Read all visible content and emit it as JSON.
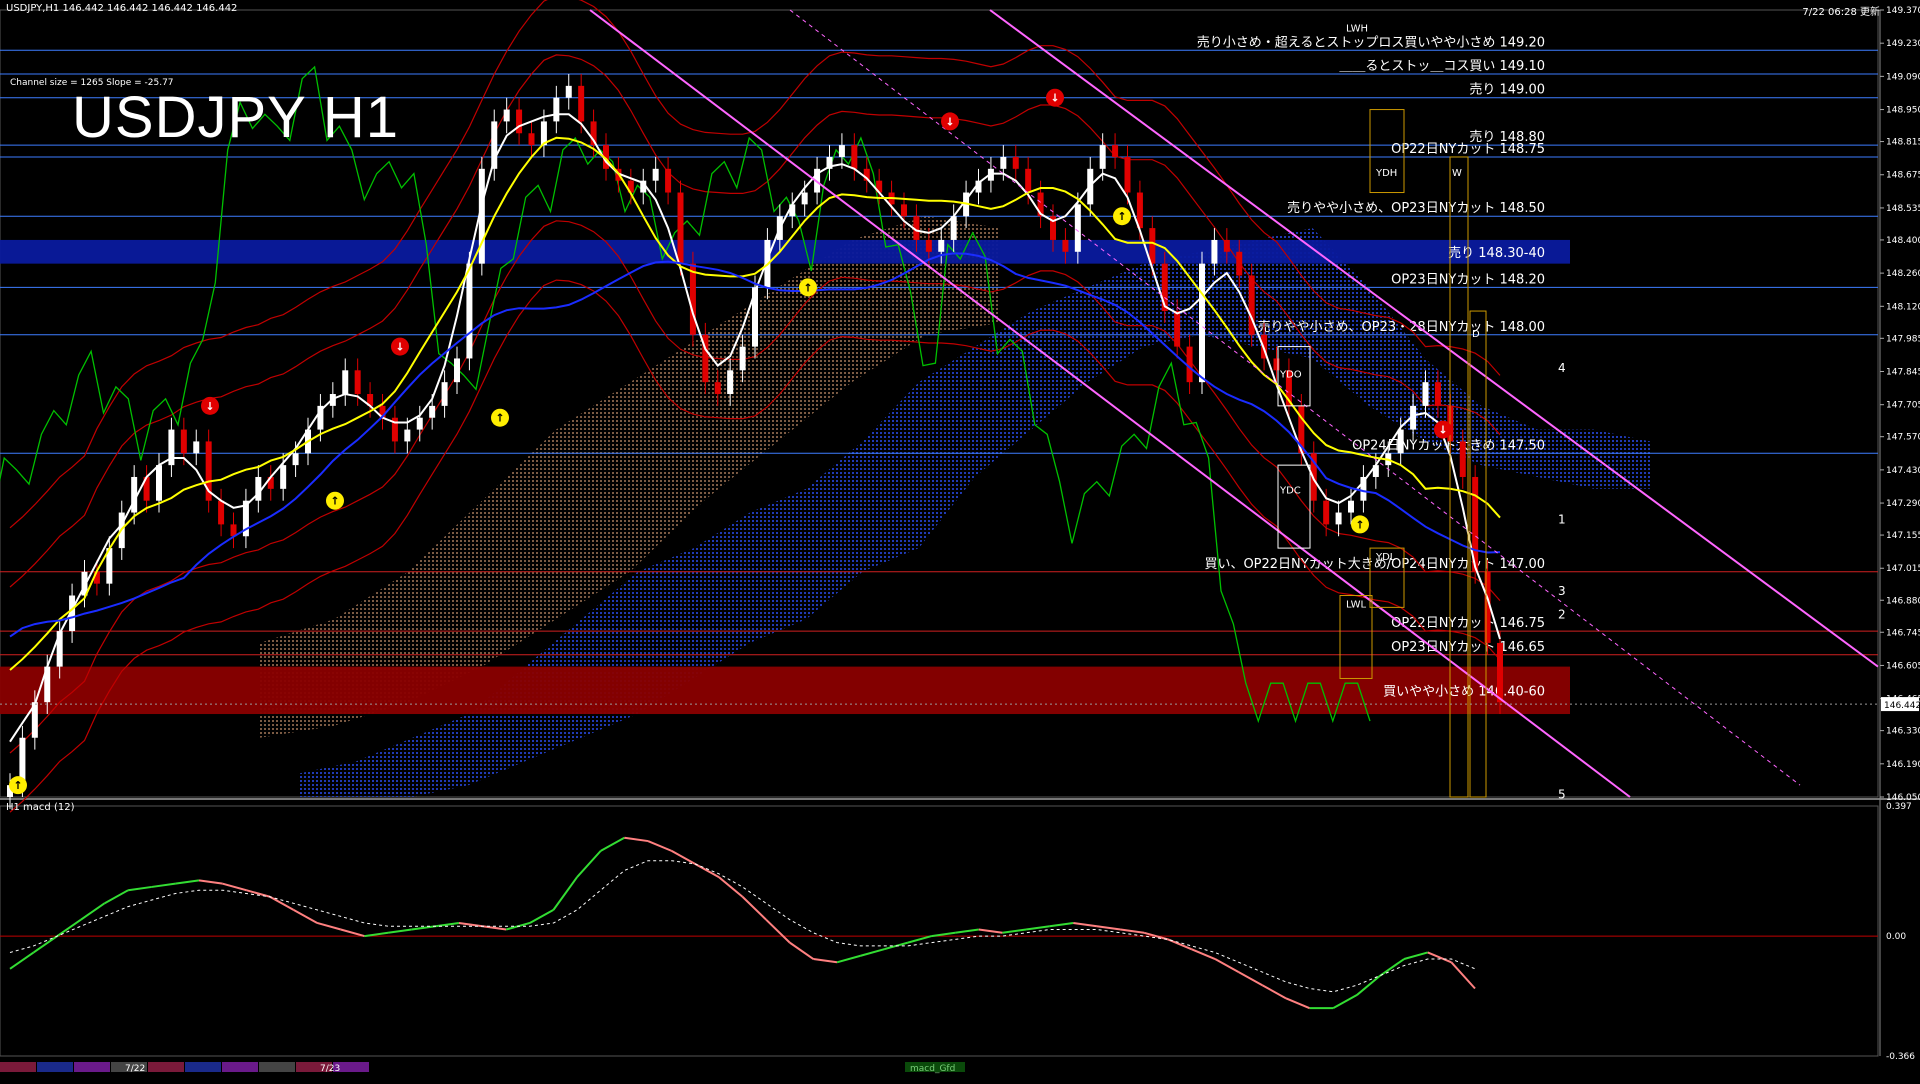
{
  "header": {
    "symbol_info": "USDJPY,H1  146.442 146.442 146.442 146.442",
    "updated": "7/22 06:28 更新",
    "channel_info": "Channel size = 1265 Slope = -25.77",
    "title": "USDJPY H1"
  },
  "colors": {
    "background": "#000000",
    "candle_up": "#ffffff",
    "candle_down": "#e00000",
    "ma_fast": "#ffffff",
    "ma_mid": "#ffff00",
    "ma_slow": "#1a2cff",
    "bollinger": "#c00000",
    "chikou": "#00c000",
    "channel": "#ff66ff",
    "level_line": "#3d7dff",
    "sell_zone": "#0a1a9e",
    "buy_zone": "#8a0000",
    "kumo": "#2440c8",
    "macd_up": "#33dd33",
    "macd_down": "#ff8080",
    "macd_signal": "#ffffff"
  },
  "chart_data": [
    {
      "type": "line",
      "name_hint": "price-panel",
      "ylim": [
        146.05,
        149.37
      ],
      "yaxis_ticks": [
        "149.370",
        "149.230",
        "149.090",
        "148.950",
        "148.815",
        "148.675",
        "148.535",
        "148.400",
        "148.260",
        "148.120",
        "147.985",
        "147.845",
        "147.705",
        "147.570",
        "147.430",
        "147.290",
        "147.155",
        "147.015",
        "146.880",
        "146.745",
        "146.605",
        "146.465",
        "146.330",
        "146.190",
        "146.050"
      ],
      "current_price": "146.442",
      "ohlc_close": [
        146.1,
        146.3,
        146.45,
        146.6,
        146.75,
        146.9,
        147.0,
        146.95,
        147.1,
        147.25,
        147.4,
        147.3,
        147.45,
        147.6,
        147.5,
        147.55,
        147.3,
        147.2,
        147.15,
        147.3,
        147.4,
        147.35,
        147.45,
        147.5,
        147.6,
        147.7,
        147.75,
        147.85,
        147.75,
        147.7,
        147.65,
        147.55,
        147.6,
        147.65,
        147.7,
        147.8,
        147.9,
        148.3,
        148.7,
        148.9,
        148.95,
        148.85,
        148.8,
        148.9,
        149.0,
        149.05,
        148.9,
        148.8,
        148.7,
        148.65,
        148.6,
        148.65,
        148.7,
        148.6,
        148.3,
        148.0,
        147.8,
        147.75,
        147.85,
        147.95,
        148.2,
        148.4,
        148.5,
        148.55,
        148.6,
        148.7,
        148.75,
        148.8,
        148.7,
        148.65,
        148.6,
        148.55,
        148.5,
        148.4,
        148.35,
        148.4,
        148.5,
        148.6,
        148.65,
        148.7,
        148.75,
        148.7,
        148.6,
        148.5,
        148.4,
        148.35,
        148.55,
        148.7,
        148.8,
        148.75,
        148.6,
        148.45,
        148.3,
        148.1,
        147.95,
        147.8,
        148.3,
        148.4,
        148.35,
        148.25,
        148.0,
        147.9,
        147.85,
        147.7,
        147.5,
        147.3,
        147.2,
        147.25,
        147.3,
        147.4,
        147.45,
        147.5,
        147.6,
        147.7,
        147.8,
        147.7,
        147.55,
        147.4,
        147.0,
        146.7,
        146.45
      ],
      "levels": [
        {
          "price": 149.2,
          "label": "売り小さめ・超えるとストップロス買いやや小さめ 149.20"
        },
        {
          "price": 149.1,
          "label": "＿＿るとストッ＿コス買い 149.10"
        },
        {
          "price": 149.0,
          "label": "売り 149.00"
        },
        {
          "price": 148.8,
          "label": "売り 148.80"
        },
        {
          "price": 148.75,
          "label": "OP22日NYカット 148.75"
        },
        {
          "price": 148.5,
          "label": "売りやや小さめ、OP23日NYカット 148.50"
        },
        {
          "price": 148.2,
          "label": "OP23日NYカット 148.20"
        },
        {
          "price": 148.0,
          "label": "売りやや小さめ、OP23・28日NYカット 148.00"
        },
        {
          "price": 147.5,
          "label": "OP24日NYカット大きめ 147.50"
        },
        {
          "price": 147.0,
          "label": "買い、OP22日NYカット大きめ/OP24日NYカット 147.00"
        },
        {
          "price": 146.75,
          "label": "OP22日NYカット 146.75"
        },
        {
          "price": 146.65,
          "label": "OP23日NYカット 146.65"
        }
      ],
      "zones": [
        {
          "from": 148.3,
          "to": 148.4,
          "label": "売り 148.30-40"
        },
        {
          "from": 146.4,
          "to": 146.6,
          "label": "買いやや小さめ 146.40-60"
        }
      ],
      "box_labels": [
        "YDO",
        "YDC",
        "YDH",
        "YDL",
        "LWL",
        "LWH",
        "W",
        "D"
      ],
      "channel_numbers": [
        "1",
        "2",
        "3",
        "4",
        "5"
      ]
    },
    {
      "type": "line",
      "name_hint": "macd-panel",
      "label": "H1  macd (12)",
      "ylim": [
        -0.366,
        0.397
      ],
      "yaxis_ticks": [
        "0.397",
        "0.00",
        "-0.366"
      ],
      "macd": [
        -0.1,
        -0.05,
        0.0,
        0.05,
        0.1,
        0.14,
        0.15,
        0.16,
        0.17,
        0.16,
        0.14,
        0.12,
        0.08,
        0.04,
        0.02,
        0.0,
        0.01,
        0.02,
        0.03,
        0.04,
        0.03,
        0.02,
        0.04,
        0.08,
        0.18,
        0.26,
        0.3,
        0.29,
        0.26,
        0.22,
        0.18,
        0.12,
        0.05,
        -0.02,
        -0.07,
        -0.08,
        -0.06,
        -0.04,
        -0.02,
        0.0,
        0.01,
        0.02,
        0.01,
        0.02,
        0.03,
        0.04,
        0.03,
        0.02,
        0.01,
        -0.01,
        -0.04,
        -0.07,
        -0.11,
        -0.15,
        -0.19,
        -0.22,
        -0.22,
        -0.18,
        -0.12,
        -0.07,
        -0.05,
        -0.08,
        -0.16
      ],
      "signal": [
        -0.05,
        -0.03,
        0.0,
        0.03,
        0.06,
        0.09,
        0.11,
        0.13,
        0.14,
        0.14,
        0.13,
        0.12,
        0.1,
        0.08,
        0.06,
        0.04,
        0.03,
        0.03,
        0.03,
        0.03,
        0.03,
        0.03,
        0.03,
        0.04,
        0.08,
        0.14,
        0.2,
        0.23,
        0.23,
        0.22,
        0.19,
        0.15,
        0.1,
        0.05,
        0.01,
        -0.02,
        -0.03,
        -0.03,
        -0.03,
        -0.02,
        -0.01,
        0.0,
        0.0,
        0.01,
        0.02,
        0.02,
        0.02,
        0.01,
        0.0,
        -0.01,
        -0.03,
        -0.05,
        -0.08,
        -0.11,
        -0.14,
        -0.16,
        -0.17,
        -0.15,
        -0.12,
        -0.09,
        -0.07,
        -0.07,
        -0.1
      ]
    }
  ],
  "timeline": {
    "labels": [
      "7/22",
      "7/23"
    ],
    "indicator_label": "macd_Gfd"
  }
}
